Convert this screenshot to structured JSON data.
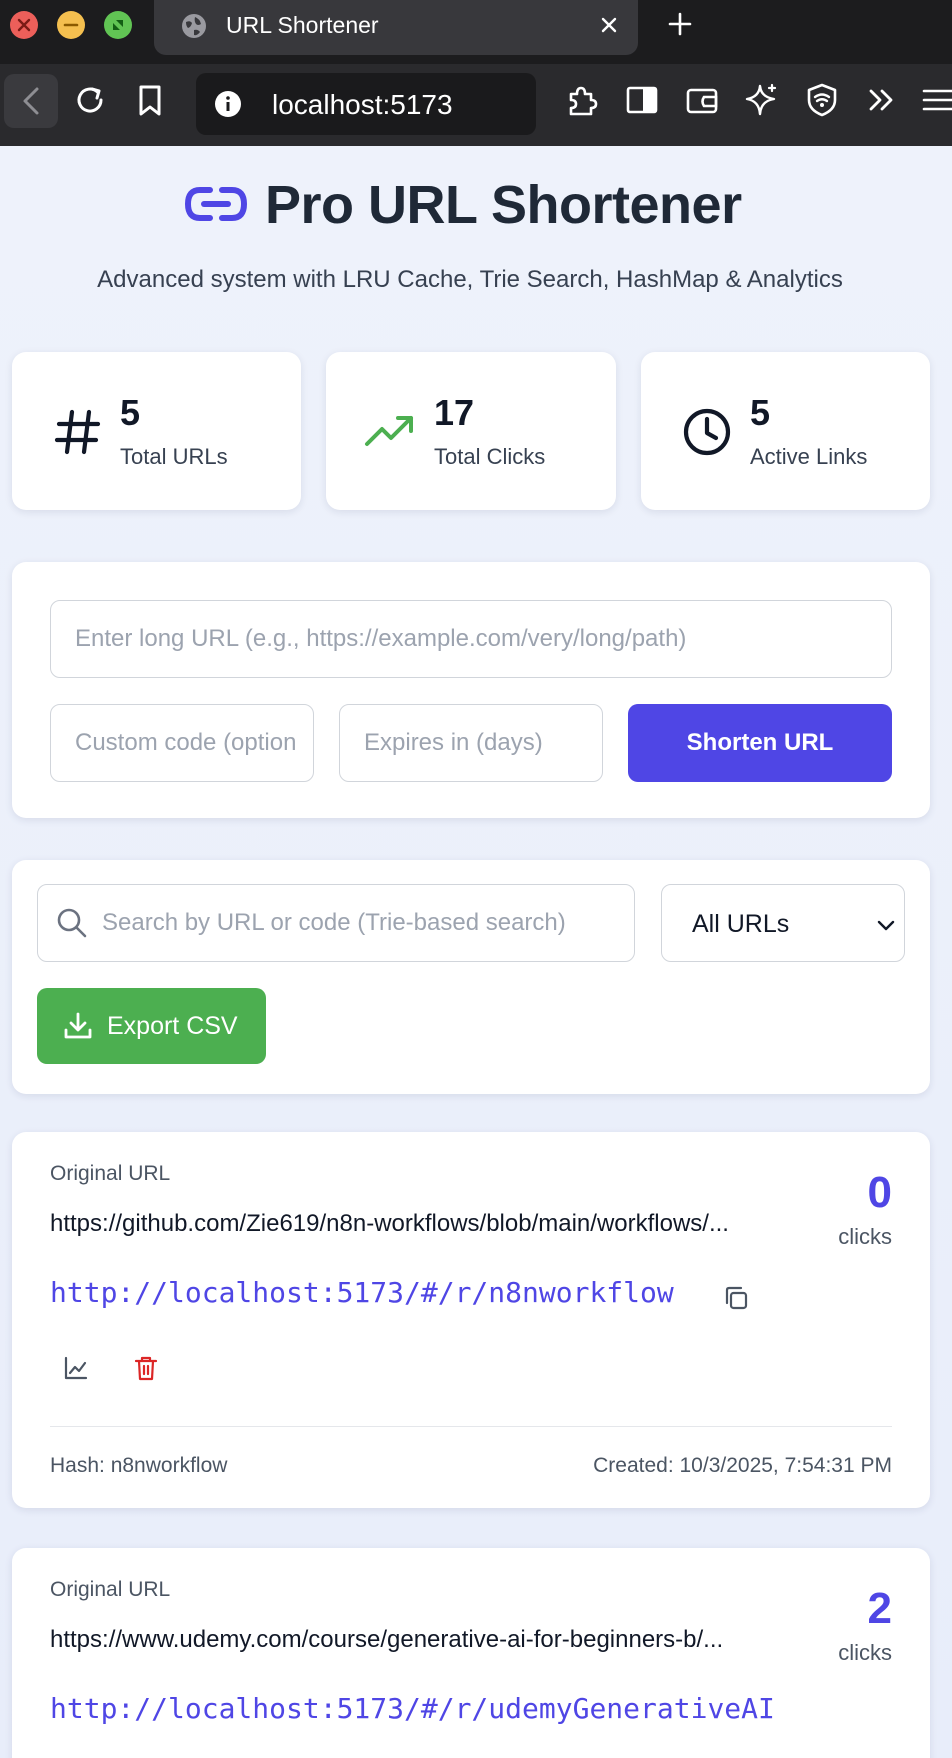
{
  "browser": {
    "tab_title": "URL Shortener",
    "address": "localhost:5173"
  },
  "header": {
    "title": "Pro URL Shortener",
    "subtitle": "Advanced system with LRU Cache, Trie Search, HashMap & Analytics",
    "icon": "link-icon",
    "accent": "#4f46e5"
  },
  "stats": [
    {
      "value": "5",
      "label": "Total URLs",
      "icon": "hash-icon"
    },
    {
      "value": "17",
      "label": "Total Clicks",
      "icon": "trending-up-icon"
    },
    {
      "value": "5",
      "label": "Active Links",
      "icon": "clock-icon"
    }
  ],
  "form": {
    "url_placeholder": "Enter long URL (e.g., https://example.com/very/long/path)",
    "custom_placeholder": "Custom code (optional)",
    "expires_placeholder": "Expires in (days)",
    "submit_label": "Shorten URL"
  },
  "toolbar": {
    "search_placeholder": "Search by URL or code (Trie-based search)",
    "filter_selected": "All URLs",
    "export_label": "Export CSV",
    "export_color": "#4caf50"
  },
  "urls": [
    {
      "original_label": "Original URL",
      "original": "https://github.com/Zie619/n8n-workflows/blob/main/workflows/...",
      "short": "http://localhost:5173/#/r/n8nworkflow",
      "clicks": "0",
      "clicks_label": "clicks",
      "hash": "Hash: n8nworkflow",
      "created": "Created: 10/3/2025, 7:54:31 PM"
    },
    {
      "original_label": "Original URL",
      "original": "https://www.udemy.com/course/generative-ai-for-beginners-b/...",
      "short": "http://localhost:5173/#/r/udemyGenerativeAI",
      "clicks": "2",
      "clicks_label": "clicks"
    }
  ]
}
